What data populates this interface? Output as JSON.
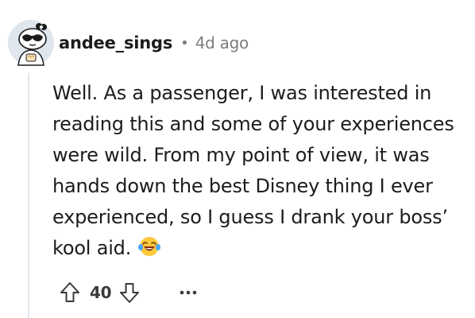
{
  "comment": {
    "username": "andee_sings",
    "separator": "•",
    "age": "4d ago",
    "body": "Well. As a passenger, I was interested in reading this and some of your experiences were wild. From my point of view, it was hands down the best Disney thing I ever experienced, so I guess I drank your boss’ kool aid.",
    "emoji": "face-with-tears-of-joy",
    "score": "40",
    "avatar_icon": "snoo-avatar-icon"
  },
  "icons": {
    "upvote": "upvote-arrow-icon",
    "downvote": "downvote-arrow-icon",
    "more": "more-options-icon"
  },
  "colors": {
    "text": "#1c1c1c",
    "meta": "#7c7c7c",
    "thread_line": "#e5e8ea"
  }
}
